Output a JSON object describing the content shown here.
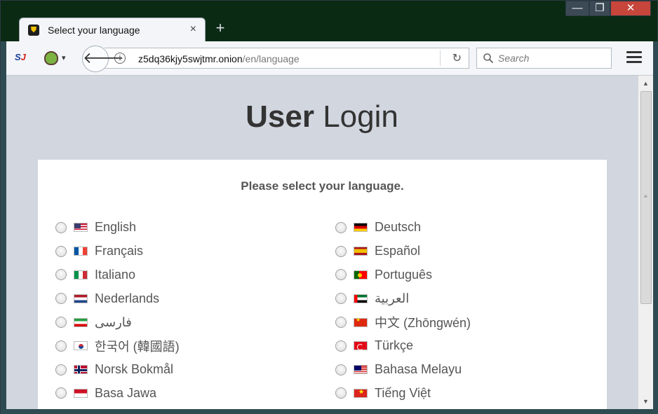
{
  "window": {
    "minimize_symbol": "—",
    "maximize_symbol": "❐",
    "close_symbol": "✕"
  },
  "tab": {
    "title": "Select your language",
    "close_symbol": "×",
    "favicon": "shield-icon",
    "new_tab_symbol": "+"
  },
  "toolbar": {
    "sj_label_a": "S",
    "sj_label_b": "J",
    "onion_caret": "▾",
    "back_symbol": "🡐",
    "url_host": "z5dq36kjy5swjtmr.onion",
    "url_path": "/en/language",
    "info_symbol": "i",
    "reload_symbol": "↻",
    "search_placeholder": "Search"
  },
  "page": {
    "heading_bold": "User",
    "heading_light": "Login",
    "prompt": "Please select your language."
  },
  "languages": {
    "left": [
      {
        "label": "English",
        "flag": "flag-us"
      },
      {
        "label": "Français",
        "flag": "flag-fr"
      },
      {
        "label": "Italiano",
        "flag": "flag-it"
      },
      {
        "label": "Nederlands",
        "flag": "flag-nl"
      },
      {
        "label": "فارسی",
        "flag": "flag-ir"
      },
      {
        "label": "한국어 (韓國語)",
        "flag": "flag-kr"
      },
      {
        "label": "Norsk Bokmål",
        "flag": "flag-no"
      },
      {
        "label": "Basa Jawa",
        "flag": "flag-id"
      }
    ],
    "right": [
      {
        "label": "Deutsch",
        "flag": "flag-de"
      },
      {
        "label": "Español",
        "flag": "flag-es"
      },
      {
        "label": "Português",
        "flag": "flag-pt"
      },
      {
        "label": "العربية",
        "flag": "flag-ae"
      },
      {
        "label": "中文 (Zhōngwén)",
        "flag": "flag-cn"
      },
      {
        "label": "Türkçe",
        "flag": "flag-tr"
      },
      {
        "label": "Bahasa Melayu",
        "flag": "flag-my"
      },
      {
        "label": "Tiếng Việt",
        "flag": "flag-vn"
      }
    ]
  },
  "scrollbar": {
    "up_symbol": "▲",
    "down_symbol": "▼",
    "grip_symbol": "≡"
  }
}
